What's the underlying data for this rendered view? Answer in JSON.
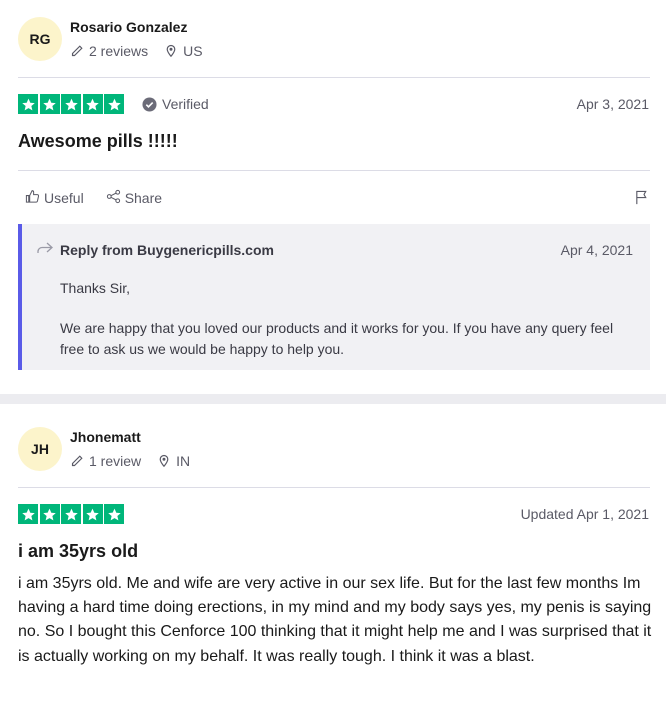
{
  "reviews": [
    {
      "initials": "RG",
      "name": "Rosario Gonzalez",
      "reviews_count": "2 reviews",
      "country": "US",
      "rating": 5,
      "verified_label": "Verified",
      "date": "Apr 3, 2021",
      "title": "Awesome pills !!!!!",
      "actions": {
        "useful": "Useful",
        "share": "Share"
      },
      "reply": {
        "title": "Reply from Buygenericpills.com",
        "date": "Apr 4, 2021",
        "greeting": "Thanks Sir,",
        "message": "We are happy that you loved our products and it works for you. If you have any query feel free to ask us we would be happy to help you."
      }
    },
    {
      "initials": "JH",
      "name": "Jhonematt",
      "reviews_count": "1 review",
      "country": "IN",
      "rating": 5,
      "date": "Updated Apr 1, 2021",
      "title": "i am 35yrs old",
      "body": "i am 35yrs old. Me and wife are very active in our sex life. But for the last few months Im having a hard time doing erections, in my mind and my body says yes, my penis is saying no. So I bought this Cenforce 100 thinking that it might help me and I was surprised that it is actually working on my behalf. It was really tough. I think it was a blast."
    }
  ],
  "colors": {
    "star_green": "#00b67a",
    "avatar_bg": "#fcf4cb",
    "reply_accent": "#5a5be8",
    "reply_bg": "#f1f1f4"
  },
  "icons": [
    "pencil-icon",
    "location-pin-icon",
    "star-icon",
    "verified-check-icon",
    "thumbs-up-icon",
    "share-icon",
    "flag-icon",
    "reply-arrow-icon"
  ]
}
